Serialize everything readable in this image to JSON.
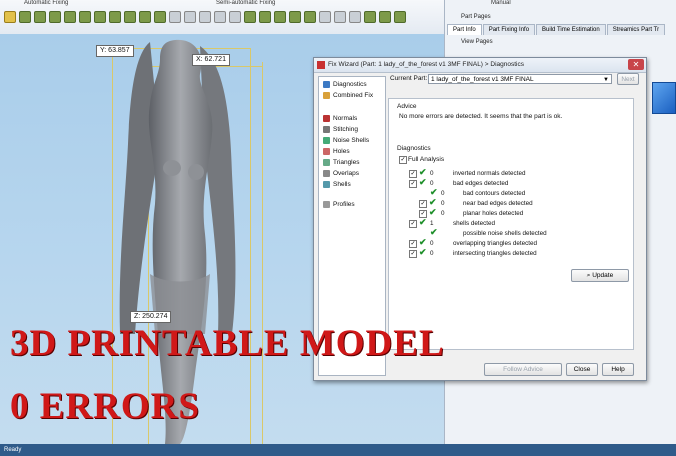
{
  "ribbon": {
    "group_automatic": "Automatic Fixing",
    "group_semi": "Semi-automatic Fixing",
    "group_manual": "Manual"
  },
  "right_panel": {
    "part_pages_label": "Part Pages",
    "tabs": [
      "Part Info",
      "Part Fixing Info",
      "Build Time Estimation",
      "Streamics Part Tr"
    ],
    "view_pages_label": "View Pages"
  },
  "viewport": {
    "label_y": "Y: 63.857",
    "label_x": "X: 62.721",
    "label_z": "Z: 250.274"
  },
  "banner": {
    "line1": "3D PRINTABLE MODEL",
    "line2": "0 ERRORS"
  },
  "status_text": "Ready",
  "dialog": {
    "title": "Fix Wizard (Part: 1 lady_of_the_forest v1 3MF FINAL) > Diagnostics",
    "nav": [
      "Diagnostics",
      "Combined Fix",
      "Normals",
      "Stitching",
      "Noise Shells",
      "Holes",
      "Triangles",
      "Overlaps",
      "Shells",
      "Profiles"
    ],
    "current_part_label": "Current Part:",
    "current_part_value": "1 lady_of_the_forest v1 3MF FINAL",
    "next_label": "Next",
    "advice_title": "Advice",
    "advice_text": "No more errors are detected. It seems that the part is ok.",
    "diagnostics_title": "Diagnostics",
    "full_analysis_label": "Full Analysis",
    "rows": [
      {
        "count": "0",
        "label": "inverted normals detected"
      },
      {
        "count": "0",
        "label": "bad edges detected"
      },
      {
        "count": "0",
        "label": "bad contours detected"
      },
      {
        "count": "0",
        "label": "near bad edges detected"
      },
      {
        "count": "0",
        "label": "planar holes detected"
      },
      {
        "count": "1",
        "label": "shells detected"
      },
      {
        "count": "",
        "label": "possible noise shells detected"
      },
      {
        "count": "0",
        "label": "overlapping triangles detected"
      },
      {
        "count": "0",
        "label": "intersecting triangles detected"
      }
    ],
    "update_label": "Update",
    "follow_advice_label": "Follow Advice",
    "close_label": "Close",
    "help_label": "Help"
  },
  "colors": {
    "accent_blue": "#2f5b8a",
    "banner_red": "#d01818",
    "check_green": "#1e8f2a"
  }
}
